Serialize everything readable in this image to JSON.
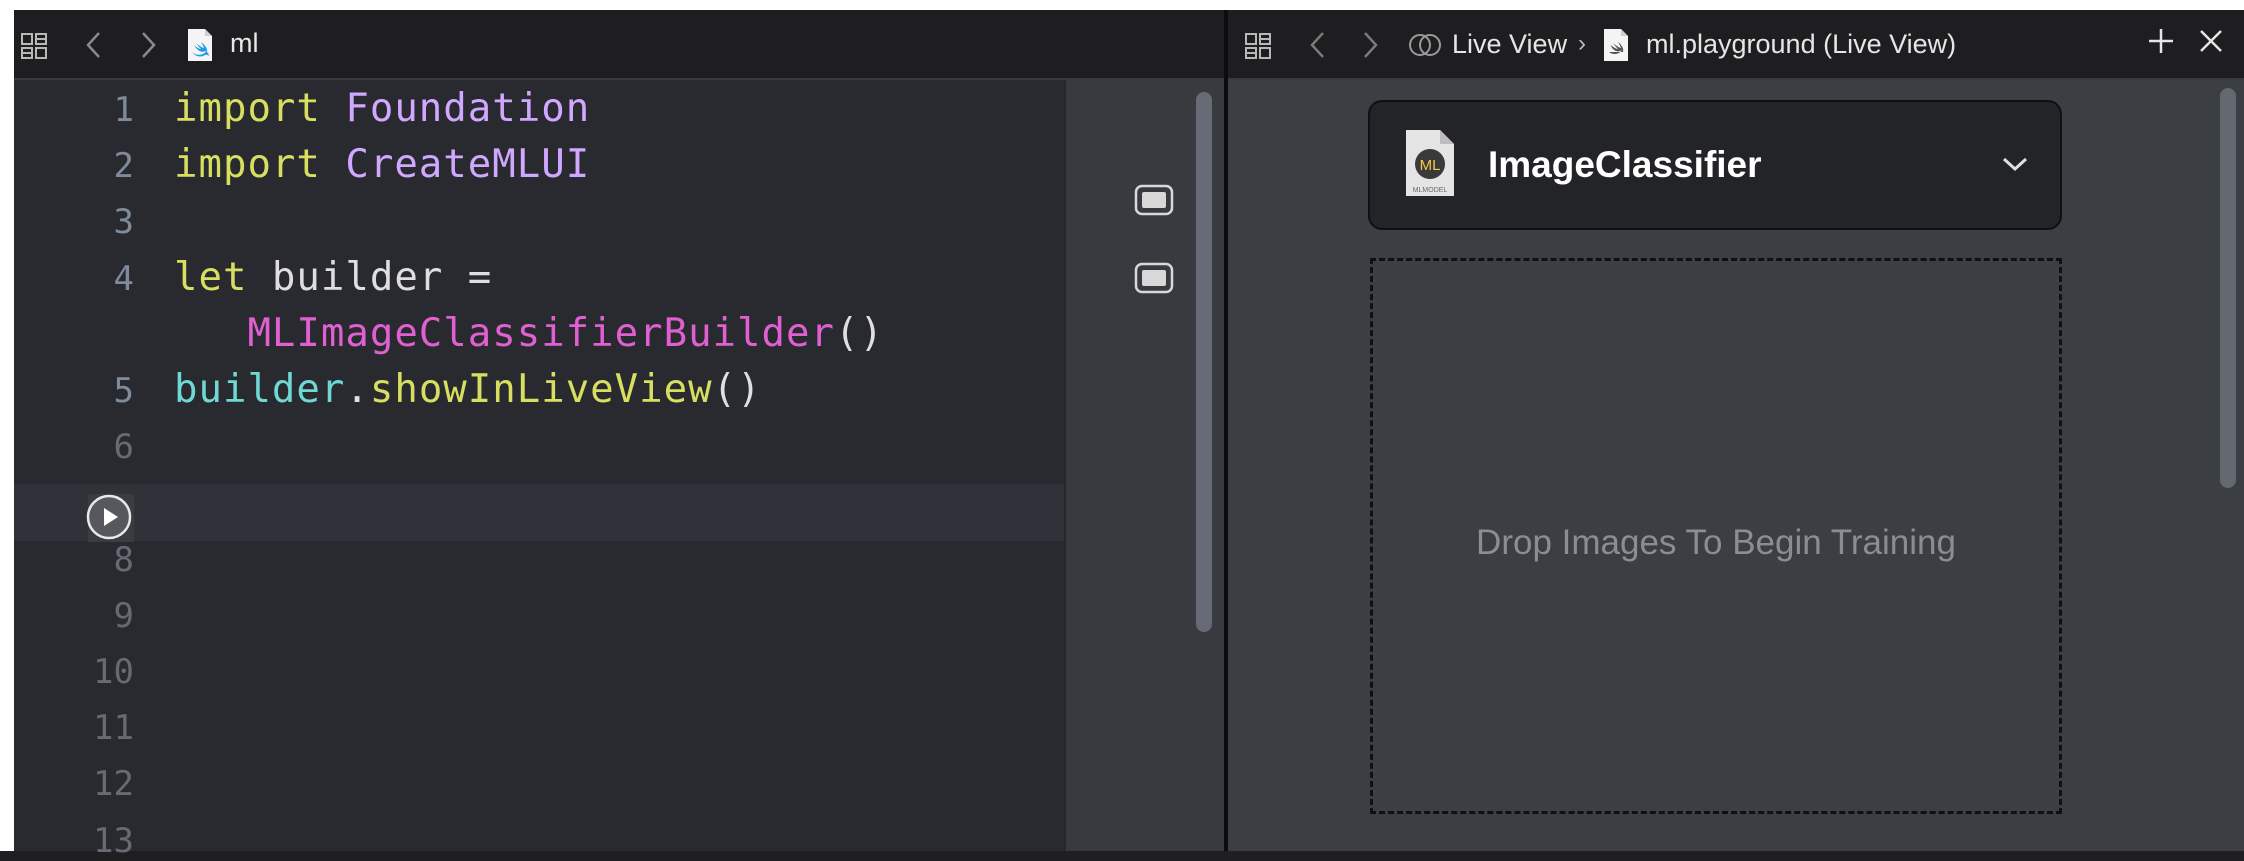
{
  "editor": {
    "file_name": "ml",
    "lines": [
      {
        "num": "1",
        "segments": [
          {
            "t": "import",
            "c": "kw"
          },
          {
            "t": " Foundation",
            "c": "ty"
          }
        ]
      },
      {
        "num": "2",
        "segments": [
          {
            "t": "import",
            "c": "kw"
          },
          {
            "t": " CreateMLUI",
            "c": "ty"
          }
        ]
      },
      {
        "num": "3",
        "segments": []
      },
      {
        "num": "4",
        "segments": [
          {
            "t": "let",
            "c": "kw"
          },
          {
            "t": " builder =",
            "c": "pl"
          }
        ]
      },
      {
        "num": "",
        "segments": [
          {
            "t": "   MLImageClassifierBuilder",
            "c": "cls"
          },
          {
            "t": "()",
            "c": "pl"
          }
        ]
      },
      {
        "num": "5",
        "segments": [
          {
            "t": "builder",
            "c": "var"
          },
          {
            "t": ".",
            "c": "pl"
          },
          {
            "t": "showInLiveView",
            "c": "fn"
          },
          {
            "t": "()",
            "c": "pl"
          }
        ]
      },
      {
        "num": "6",
        "segments": []
      },
      {
        "num": "",
        "segments": []
      },
      {
        "num": "8",
        "segments": []
      },
      {
        "num": "9",
        "segments": []
      },
      {
        "num": "10",
        "segments": []
      },
      {
        "num": "11",
        "segments": []
      },
      {
        "num": "12",
        "segments": []
      },
      {
        "num": "13",
        "segments": []
      }
    ],
    "current_line": 7,
    "run_button_icon": "play-circle-icon",
    "result_icons": [
      "quick-look-icon",
      "quick-look-icon"
    ]
  },
  "live_view": {
    "breadcrumb_1": "Live View",
    "breadcrumb_sep": "›",
    "breadcrumb_2": "ml.playground (Live View)",
    "classifier_title": "ImageClassifier",
    "ml_badge": "ML",
    "ml_caption": "MLMODEL",
    "drop_text": "Drop Images To Begin Training"
  },
  "colors": {
    "editor_bg": "#292a30",
    "keyword": "#d8df60",
    "type": "#d0a8ff",
    "class": "#e060d2",
    "variable": "#6fd8d3",
    "live_bg": "#3b3e42"
  }
}
